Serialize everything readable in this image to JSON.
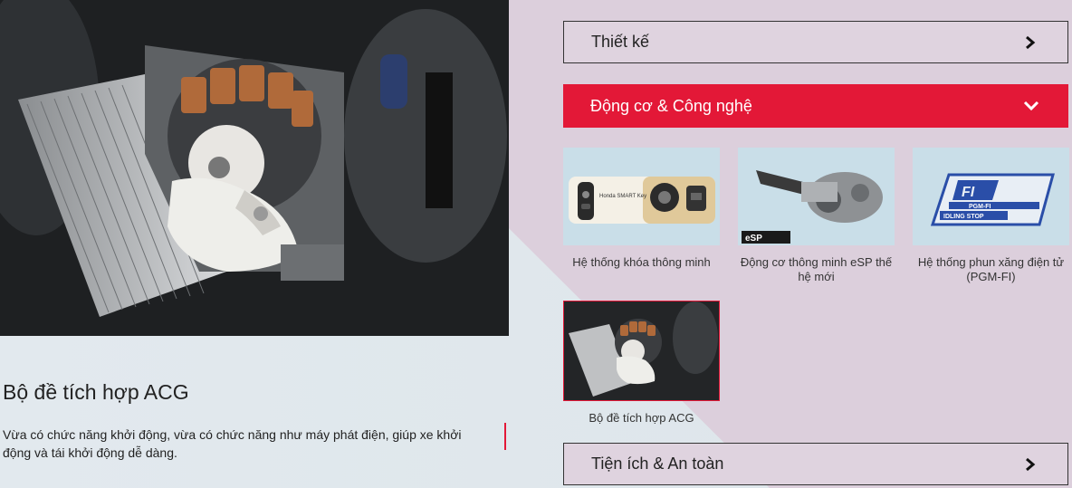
{
  "hero": {
    "title": "Bộ đề tích hợp ACG",
    "description": "Vừa có chức năng khởi động, vừa có chức năng như máy phát điện, giúp xe khởi động và tái khởi động dễ dàng."
  },
  "accordion": {
    "design_label": "Thiết kế",
    "engine_label": "Động cơ & Công nghệ",
    "utility_label": "Tiện ích & An toàn"
  },
  "cards": [
    {
      "caption": "Hệ thống khóa thông minh",
      "thumb_text": "Honda SMART Key"
    },
    {
      "caption": "Động cơ thông minh eSP thế hệ mới",
      "thumb_text": "eSP"
    },
    {
      "caption": "Hệ thống phun xăng điện tử (PGM-FI)",
      "thumb_text_1": "PGM-FI",
      "thumb_text_2": "IDLING STOP"
    },
    {
      "caption": "Bộ đề tích hợp ACG"
    }
  ],
  "colors": {
    "accent": "#e31837",
    "text": "#222222"
  }
}
